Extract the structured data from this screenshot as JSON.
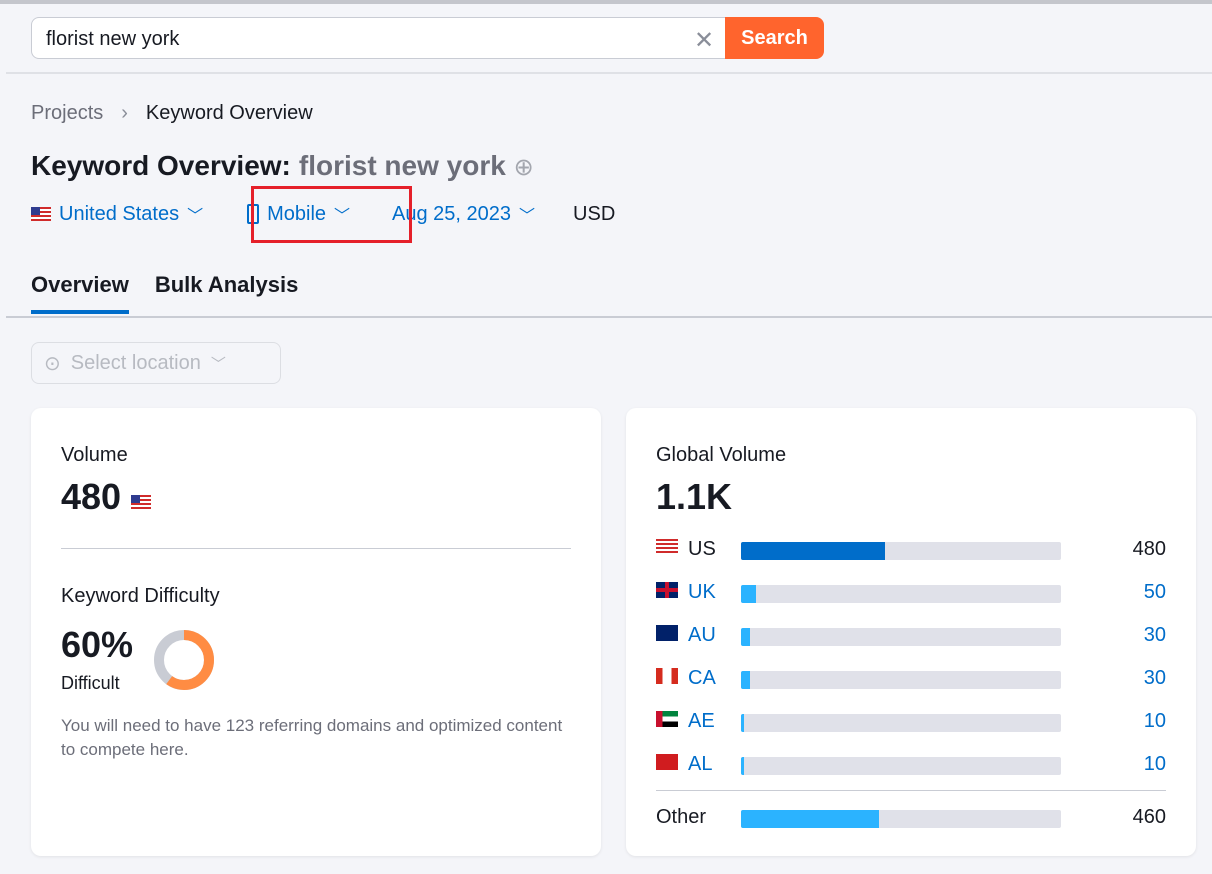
{
  "search": {
    "value": "florist new york",
    "button": "Search"
  },
  "breadcrumb": {
    "parent": "Projects",
    "current": "Keyword Overview"
  },
  "title": {
    "label": "Keyword Overview:",
    "keyword": "florist new york"
  },
  "filters": {
    "country": "United States",
    "device": "Mobile",
    "date": "Aug 25, 2023",
    "currency": "USD"
  },
  "tabs": [
    {
      "label": "Overview",
      "active": true
    },
    {
      "label": "Bulk Analysis",
      "active": false
    }
  ],
  "location": {
    "placeholder": "Select location"
  },
  "volume": {
    "label": "Volume",
    "value": "480"
  },
  "difficulty": {
    "label": "Keyword Difficulty",
    "value": "60%",
    "percent": 60,
    "level": "Difficult",
    "note": "You will need to have 123 referring domains and optimized content to compete here."
  },
  "global": {
    "label": "Global Volume",
    "value": "1.1K",
    "total": 1070,
    "rows": [
      {
        "code": "US",
        "value": 480,
        "color": "#006dca"
      },
      {
        "code": "UK",
        "value": 50
      },
      {
        "code": "AU",
        "value": 30
      },
      {
        "code": "CA",
        "value": 30
      },
      {
        "code": "AE",
        "value": 10
      },
      {
        "code": "AL",
        "value": 10
      }
    ],
    "other": {
      "label": "Other",
      "value": 460
    }
  },
  "colors": {
    "accent": "#006dca",
    "search": "#ff642d",
    "bar": "#2bb3ff",
    "difficulty": "#ff8c43",
    "highlight": "#e5202a"
  }
}
